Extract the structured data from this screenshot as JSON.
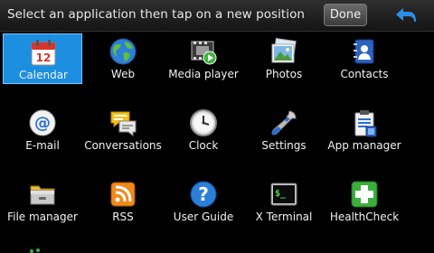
{
  "topbar": {
    "instruction": "Select an application then tap on a new position",
    "done_label": "Done",
    "back_icon": "back-arrow-icon"
  },
  "apps": [
    {
      "label": "Calendar",
      "icon": "calendar-icon",
      "selected": true,
      "calendar_day": "12"
    },
    {
      "label": "Web",
      "icon": "globe-icon"
    },
    {
      "label": "Media player",
      "icon": "media-player-icon"
    },
    {
      "label": "Photos",
      "icon": "photos-icon"
    },
    {
      "label": "Contacts",
      "icon": "contacts-icon"
    },
    {
      "label": "E-mail",
      "icon": "email-icon"
    },
    {
      "label": "Conversations",
      "icon": "conversations-icon"
    },
    {
      "label": "Clock",
      "icon": "clock-icon"
    },
    {
      "label": "Settings",
      "icon": "settings-icon"
    },
    {
      "label": "App manager",
      "icon": "app-manager-icon"
    },
    {
      "label": "File manager",
      "icon": "file-manager-icon"
    },
    {
      "label": "RSS",
      "icon": "rss-icon"
    },
    {
      "label": "User Guide",
      "icon": "user-guide-icon"
    },
    {
      "label": "X Terminal",
      "icon": "terminal-icon",
      "terminal_prompt": "$_"
    },
    {
      "label": "HealthCheck",
      "icon": "healthcheck-icon"
    }
  ],
  "colors": {
    "selection": "#1d8fe0",
    "accent_blue": "#2a90e8"
  }
}
